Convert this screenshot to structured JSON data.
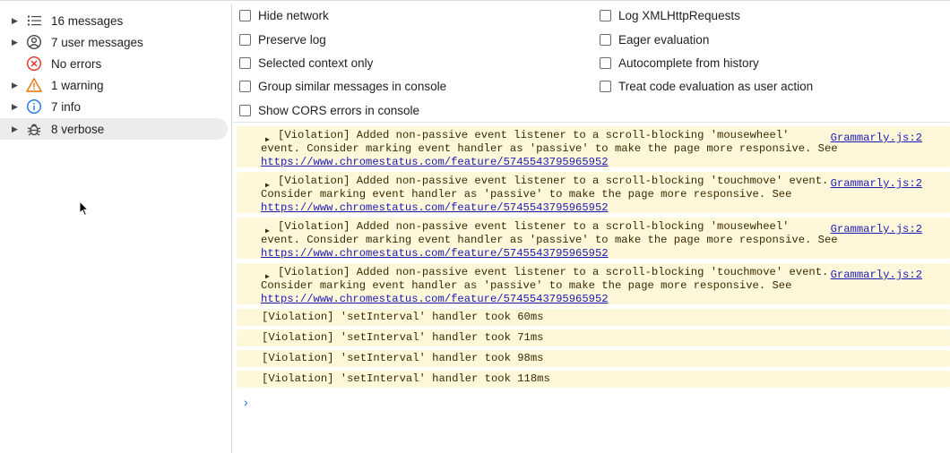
{
  "sidebar": {
    "items": [
      {
        "label": "16 messages",
        "icon": "list-icon",
        "has_arrow": true
      },
      {
        "label": "7 user messages",
        "icon": "user-circle-icon",
        "has_arrow": true
      },
      {
        "label": "No errors",
        "icon": "error-icon",
        "has_arrow": false
      },
      {
        "label": "1 warning",
        "icon": "warning-icon",
        "has_arrow": true
      },
      {
        "label": "7 info",
        "icon": "info-icon",
        "has_arrow": true
      },
      {
        "label": "8 verbose",
        "icon": "bug-icon",
        "has_arrow": true,
        "selected": true
      }
    ]
  },
  "settings": {
    "left": [
      "Hide network",
      "Preserve log",
      "Selected context only",
      "Group similar messages in console",
      "Show CORS errors in console"
    ],
    "right": [
      "Log XMLHttpRequests",
      "Eager evaluation",
      "Autocomplete from history",
      "Treat code evaluation as user action"
    ]
  },
  "console": {
    "violations": [
      {
        "line1": "[Violation] Added non-passive event listener to a scroll-blocking 'mousewheel'",
        "line2": "event. Consider marking event handler as 'passive' to make the page more responsive. See",
        "link": "https://www.chromestatus.com/feature/5745543795965952",
        "source": "Grammarly.js:2"
      },
      {
        "line1": "[Violation] Added non-passive event listener to a scroll-blocking 'touchmove' event.",
        "line2": "Consider marking event handler as 'passive' to make the page more responsive. See",
        "link": "https://www.chromestatus.com/feature/5745543795965952",
        "source": "Grammarly.js:2"
      },
      {
        "line1": "[Violation] Added non-passive event listener to a scroll-blocking 'mousewheel'",
        "line2": "event. Consider marking event handler as 'passive' to make the page more responsive. See",
        "link": "https://www.chromestatus.com/feature/5745543795965952",
        "source": "Grammarly.js:2"
      },
      {
        "line1": "[Violation] Added non-passive event listener to a scroll-blocking 'touchmove' event.",
        "line2": "Consider marking event handler as 'passive' to make the page more responsive. See",
        "link": "https://www.chromestatus.com/feature/5745543795965952",
        "source": "Grammarly.js:2"
      }
    ],
    "intervals": [
      "[Violation] 'setInterval' handler took 60ms",
      "[Violation] 'setInterval' handler took 71ms",
      "[Violation] 'setInterval' handler took 98ms",
      "[Violation] 'setInterval' handler took 118ms"
    ],
    "prompt_symbol": "›"
  },
  "colors": {
    "warning_bg": "#fef7d9",
    "link": "#1a1ab8",
    "selected_bg": "#ececef",
    "error": "#d93025",
    "warning": "#e37400",
    "info": "#1a73e8"
  }
}
